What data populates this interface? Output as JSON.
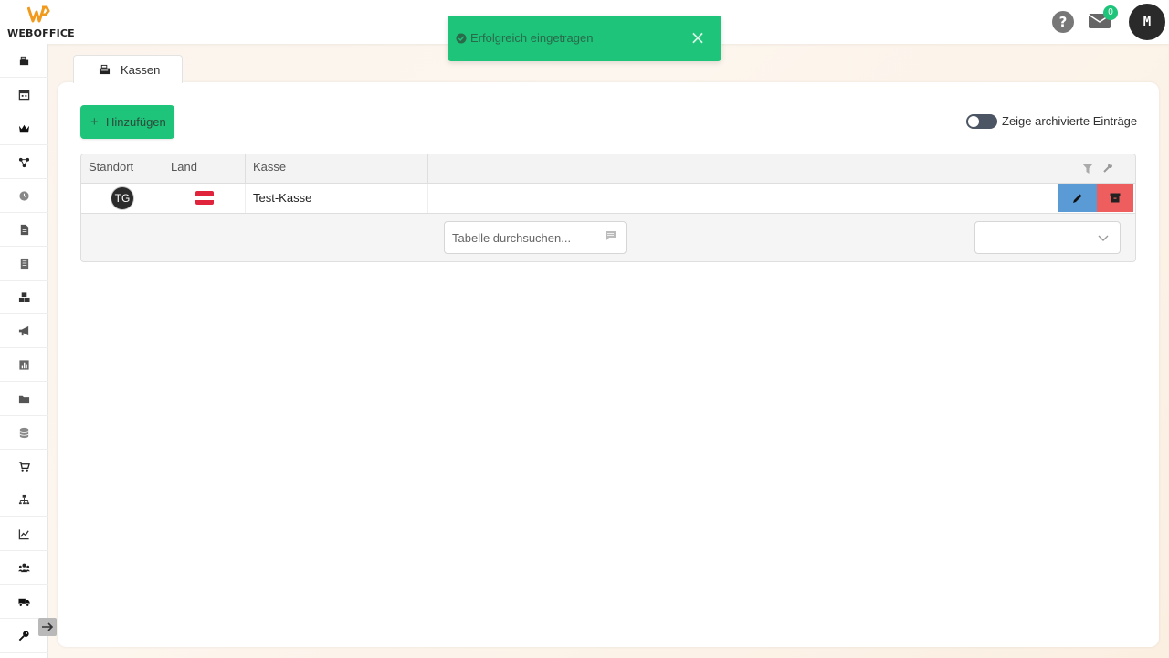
{
  "header": {
    "logo_text": "WEBOFFICE",
    "help_label": "?",
    "mail_count": "0",
    "user_initial": "M"
  },
  "toast": {
    "message": "Erfolgreich eingetragen",
    "close_label": "×",
    "color": "#1ec47a"
  },
  "sidebar": {
    "items": [
      {
        "icon": "cash-register-icon"
      },
      {
        "icon": "calendar-icon"
      },
      {
        "icon": "crown-icon"
      },
      {
        "icon": "network-icon"
      },
      {
        "icon": "clock-icon"
      },
      {
        "icon": "document-icon"
      },
      {
        "icon": "list-document-icon"
      },
      {
        "icon": "boxes-icon"
      },
      {
        "icon": "megaphone-icon"
      },
      {
        "icon": "bar-chart-icon"
      },
      {
        "icon": "folder-icon"
      },
      {
        "icon": "database-icon"
      },
      {
        "icon": "cart-icon"
      },
      {
        "icon": "hierarchy-icon"
      },
      {
        "icon": "line-chart-icon"
      },
      {
        "icon": "users-icon"
      },
      {
        "icon": "truck-icon"
      },
      {
        "icon": "key-icon"
      }
    ]
  },
  "tab": {
    "label": "Kassen",
    "icon": "cash-register-icon"
  },
  "toolbar": {
    "add_label": "Hinzufügen",
    "archive_toggle_label": "Zeige archivierte Einträge",
    "archive_toggle_on": false
  },
  "table": {
    "columns": [
      "Standort",
      "Land",
      "Kasse",
      ""
    ],
    "rows": [
      {
        "standort": "TG",
        "land_flag": "austria-flag-icon",
        "kasse": "Test-Kasse"
      }
    ],
    "search_placeholder": "Tabelle durchsuchen...",
    "page_size_value": ""
  },
  "colors": {
    "accent_green": "#1ec47a",
    "edit_blue": "#5b9bd5",
    "delete_red": "#ef5e5e",
    "flag_red": "#e0243c"
  }
}
